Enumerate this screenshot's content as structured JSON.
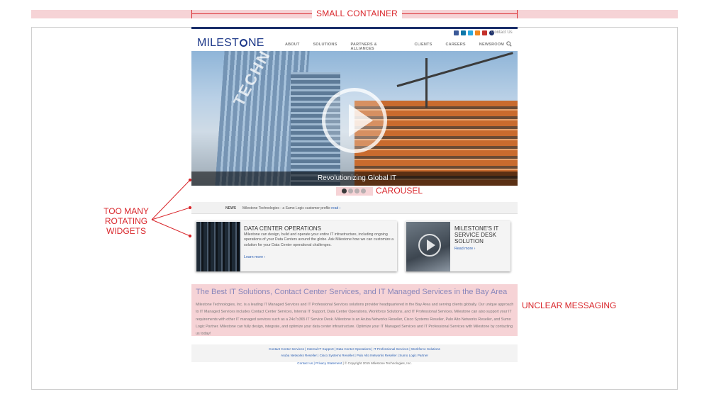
{
  "annotations": {
    "container_label": "SMALL CONTAINER",
    "carousel_label": "CAROUSEL",
    "widgets_label_lines": [
      "TOO MANY",
      "ROTATING",
      "WIDGETS"
    ],
    "messaging_label": "UNCLEAR MESSAGING",
    "accent_color": "#d9262b",
    "highlight_color": "#f6d3d6"
  },
  "site": {
    "logo": {
      "pre": "MILEST",
      "post": "NE"
    },
    "header_link": "Contact Us",
    "social_icons": [
      "facebook-icon",
      "linkedin-icon",
      "twitter-icon",
      "rss-icon",
      "youtube-icon",
      "chat-icon"
    ],
    "nav": [
      "ABOUT",
      "SOLUTIONS",
      "PARTNERS & ALLIANCES",
      "CLIENTS",
      "CAREERS",
      "NEWSROOM"
    ],
    "hero": {
      "word": "TECHNOLOGY",
      "caption": "Revolutionizing Global IT"
    },
    "carousel": {
      "count": 4,
      "active": 0
    },
    "news": {
      "tag": "NEWS",
      "text": "Milestone Technologies - a Sumo Logic customer profile",
      "link": "read ›"
    },
    "card_dc": {
      "title": "DATA CENTER OPERATIONS",
      "body": "Milestone can design, build and operate your entire IT infrastructure, including ongoing operations of your Data Centers around the globe. Ask Milestone how we can customize a solution for your Data Center operational challenges.",
      "link": "Learn more ›"
    },
    "card_sd": {
      "title": "MILESTONE'S IT SERVICE DESK SOLUTION",
      "link": "Read more ›"
    },
    "message": {
      "title": "The Best IT Solutions, Contact Center Services, and IT Managed Services in the Bay Area",
      "body": "Milestone Technologies, Inc. is a leading IT Managed Services and IT Professional Services solutions provider headquartered in the Bay Area and serving clients globally. Our unique approach to IT Managed Services includes Contact Center Services, Internal IT Support, Data Center Operations, Workforce Solutions, and IT Professional Services. Milestone can also support your IT requirements with other IT managed services such as a 24x7x365 IT Service Desk. Milestone is an Aruba Networks Reseller, Cisco Systems Reseller, Palo Alto Networks Reseller, and Sumo Logic Partner. Milestone can fully design, integrate, and optimize your data center infrastructure. Optimize your IT Managed Services and IT Professional Services with Milestone by contacting us today!"
    },
    "footer": {
      "links1": "Contact Center Services  |  Internal IT Support  |  Data Center Operations  |  IT Professional Services  |  Workforce Solutions",
      "links2": "Aruba Networks Reseller  |  Cisco Systems Reseller  |  Palo Alto Networks Reseller  |  Sumo Logic Partner",
      "copy_links": "Contact us | Privacy Statement",
      "copyright": " | © Copyright 2015 Milestone Technologies, Inc."
    }
  }
}
